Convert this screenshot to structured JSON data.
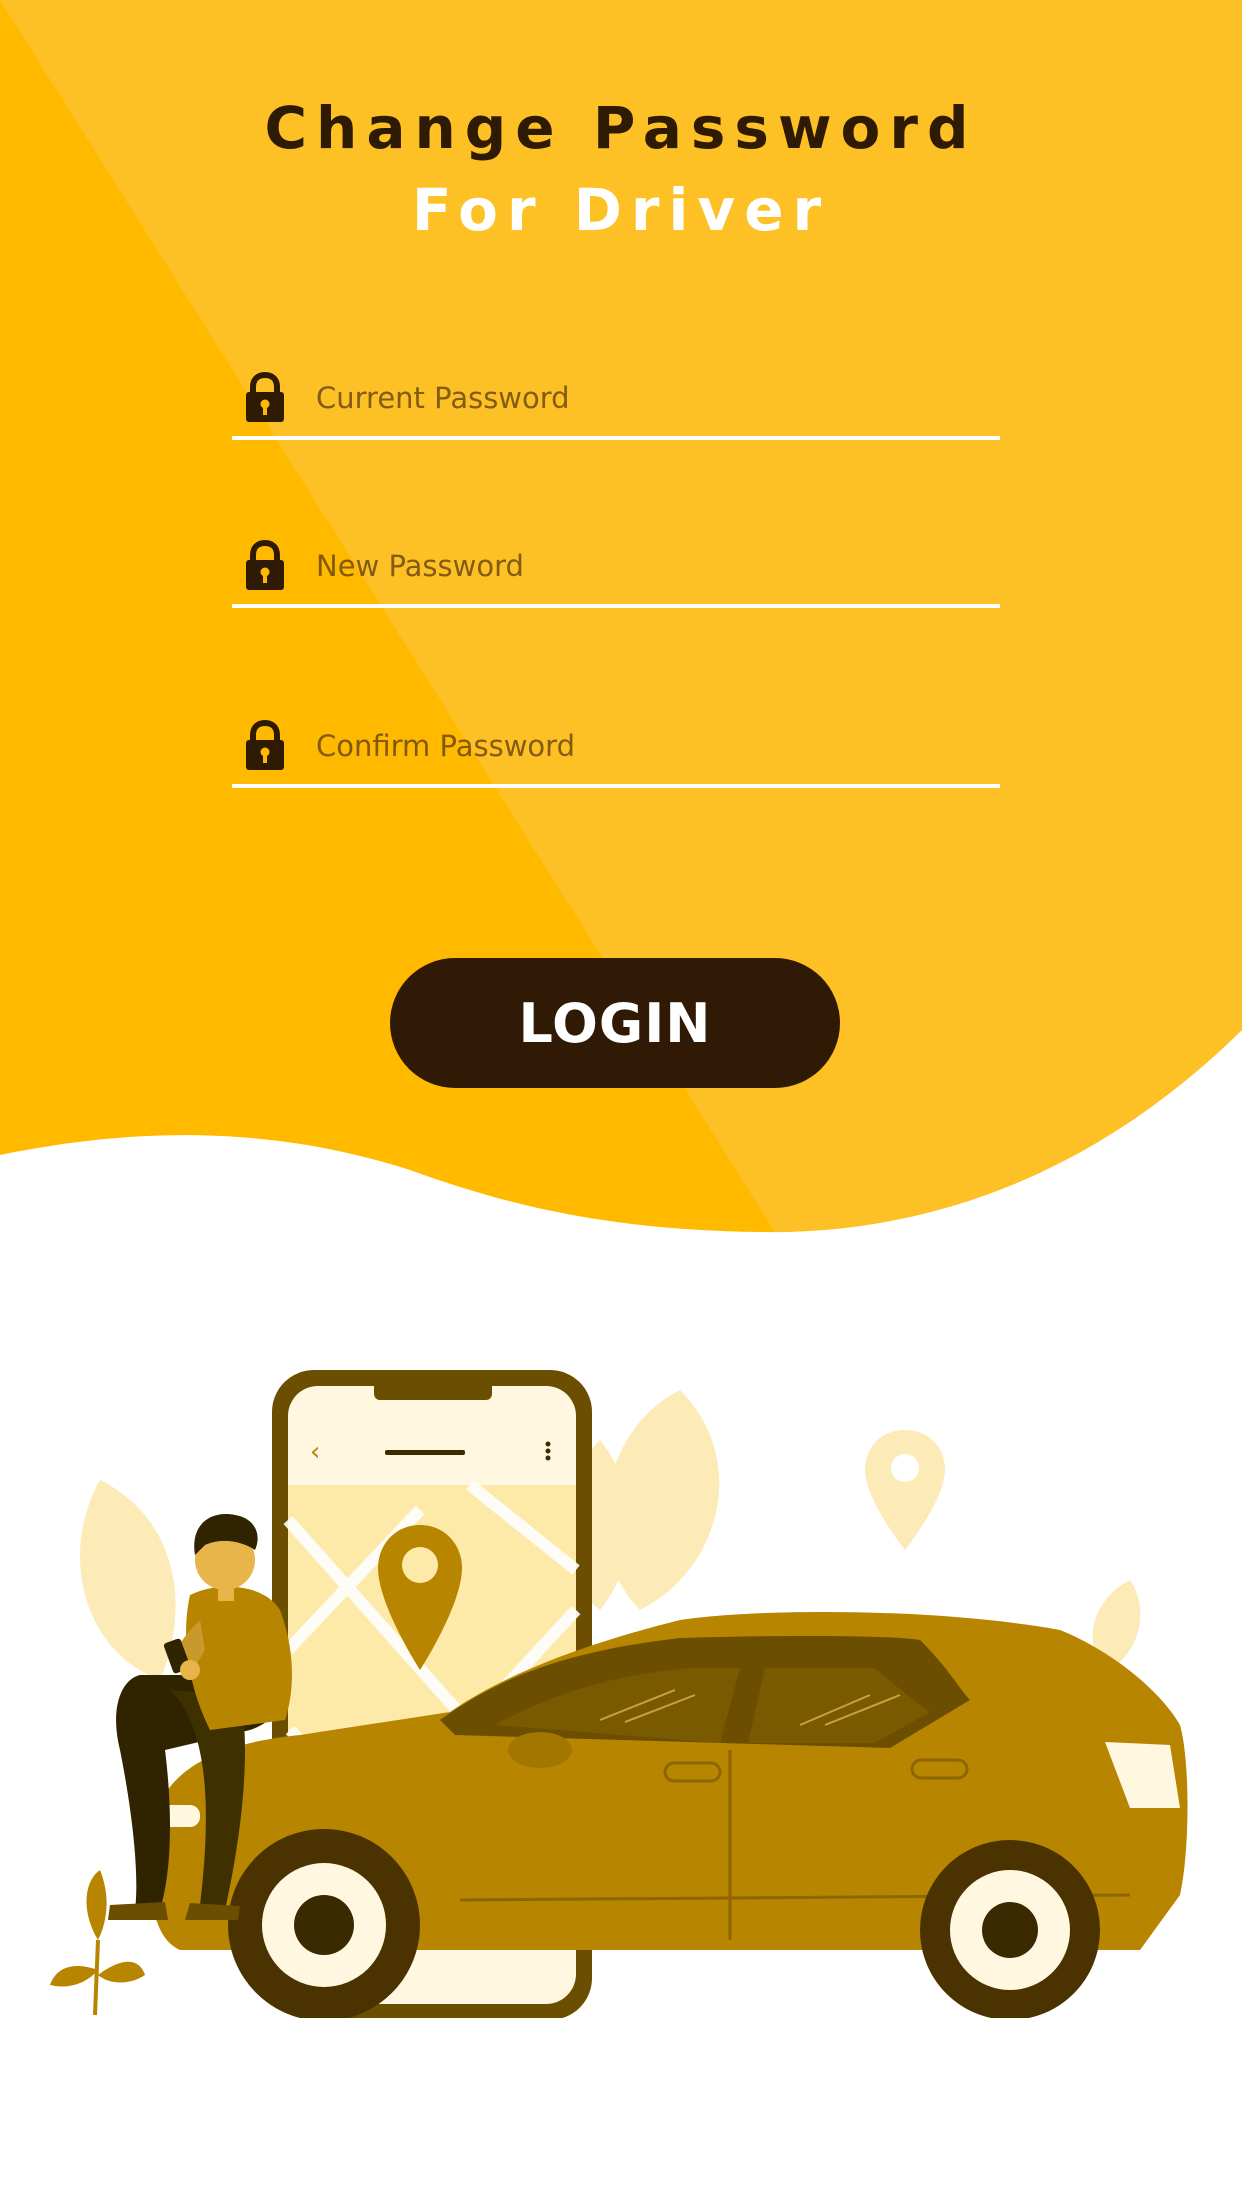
{
  "header": {
    "title_line_1": "Change Password",
    "title_line_2": "For Driver"
  },
  "form": {
    "current_password": {
      "placeholder": "Current Password",
      "value": "",
      "icon": "lock-icon"
    },
    "new_password": {
      "placeholder": "New Password",
      "value": "",
      "icon": "lock-icon"
    },
    "confirm_password": {
      "placeholder": "Confirm Password",
      "value": "",
      "icon": "lock-icon"
    },
    "submit_label": "LOGIN"
  },
  "colors": {
    "primary_yellow": "#FFBA00",
    "light_yellow": "#FDC125",
    "dark_brown": "#311A05",
    "car_body": "#B88500"
  }
}
